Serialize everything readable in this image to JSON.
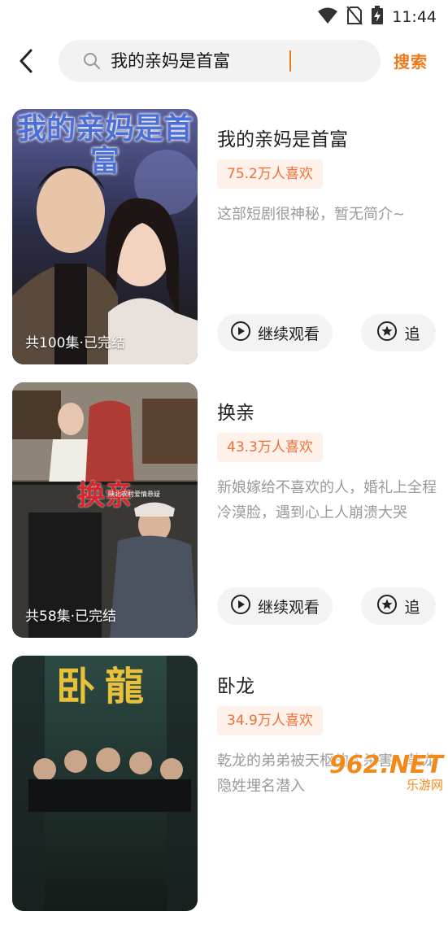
{
  "status_bar": {
    "time": "11:44",
    "icons": [
      "wifi-icon",
      "no-sim-icon",
      "battery-charging-icon"
    ]
  },
  "search": {
    "query": "我的亲妈是首富",
    "button_label": "搜索",
    "back_icon": "chevron-left-icon",
    "search_icon": "magnifier-icon"
  },
  "colors": {
    "accent": "#f07a1a",
    "likes_bg": "#fdf1ea",
    "likes_text": "#f0703a",
    "button_bg": "#f3f3f3",
    "desc_text": "#9a9a9a"
  },
  "results": [
    {
      "title": "我的亲妈是首富",
      "likes": "75.2万人喜欢",
      "description": "这部短剧很神秘，暂无简介~",
      "cover_caption": "共100集·已完结",
      "cover_title": "我的亲妈是首富",
      "continue_label": "继续观看",
      "follow_label": "追"
    },
    {
      "title": "换亲",
      "likes": "43.3万人喜欢",
      "description": "新娘嫁给不喜欢的人，婚礼上全程冷漠脸，遇到心上人崩溃大哭",
      "cover_caption": "共58集·已完结",
      "cover_title": "换亲",
      "cover_subtitle": "陕北农村爱情悬疑",
      "continue_label": "继续观看",
      "follow_label": "追"
    },
    {
      "title": "卧龙",
      "likes": "34.9万人喜欢",
      "description": "乾龙的弟弟被天枢的人杀害，乾龙隐姓埋名潜入",
      "cover_caption": "",
      "cover_title": "卧龍",
      "continue_label": "继续观看",
      "follow_label": "追"
    }
  ],
  "watermark": {
    "top": "962.NET",
    "bottom": "乐游网"
  }
}
